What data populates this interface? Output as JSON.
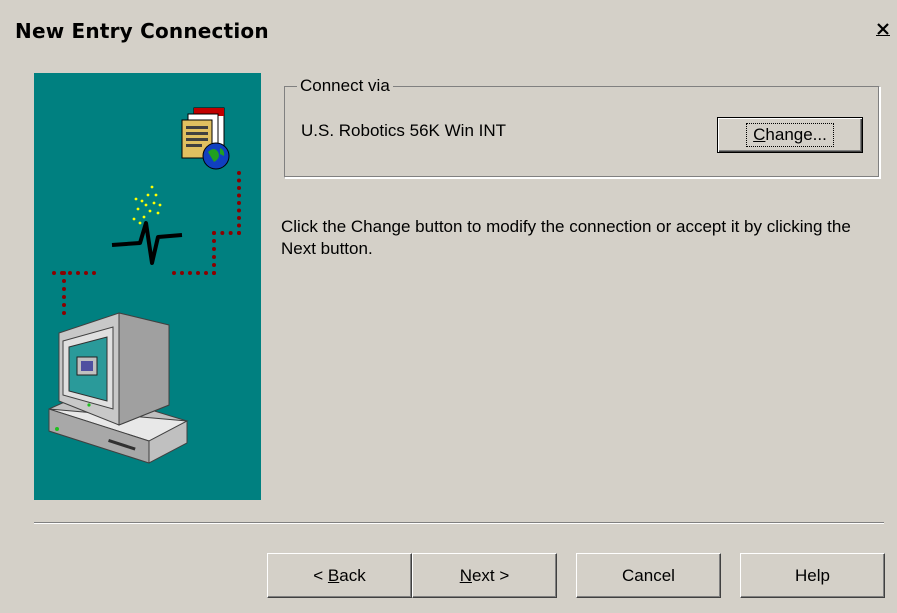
{
  "window": {
    "title": "New Entry Connection",
    "close_glyph": "✕"
  },
  "connect_via": {
    "legend": "Connect via",
    "device": "U.S. Robotics 56K Win INT",
    "change_button": {
      "accel": "C",
      "rest": "hange..."
    }
  },
  "description": "Click the Change button to modify the connection or accept it by clicking the Next button.",
  "buttons": {
    "back": {
      "prefix": "< ",
      "accel": "B",
      "rest": "ack"
    },
    "next": {
      "accel": "N",
      "rest": "ext >"
    },
    "cancel": "Cancel",
    "help": "Help"
  },
  "colors": {
    "illustration_bg": "#008080",
    "dialog_bg": "#d4d0c8"
  },
  "icons": [
    "close-icon",
    "document-globe-icon",
    "signal-spark-icon",
    "computer-icon"
  ]
}
